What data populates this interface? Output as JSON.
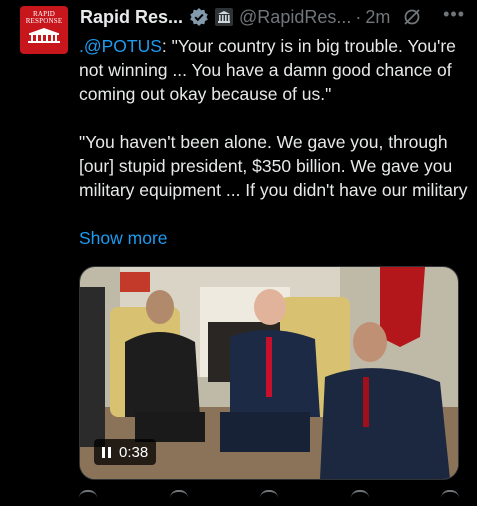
{
  "author": {
    "display_name": "Rapid Res...",
    "handle": "@RapidRes...",
    "separator": "·",
    "time": "2m",
    "avatar_text": "RAPID RESPONSE"
  },
  "tweet": {
    "mention": ".@POTUS",
    "line1_rest": ": \"Your country is in big trouble. You're not winning ... You have a damn good chance of coming out okay because of us.\"",
    "paragraph2": "\"You haven't been alone. We gave you, through [our] stupid president, $350 billion. We gave you military equipment ... If you didn't have our military",
    "show_more": "Show more"
  },
  "media": {
    "duration": "0:38"
  },
  "icons": {
    "verified": "verified-badge-icon",
    "government": "government-building-icon",
    "grok": "grok-icon",
    "more": "more-icon",
    "pause": "pause-icon"
  },
  "colors": {
    "background": "#000000",
    "text": "#e7e9ea",
    "secondary": "#71767b",
    "accent": "#1d9bf0",
    "avatar": "#c8161d"
  }
}
